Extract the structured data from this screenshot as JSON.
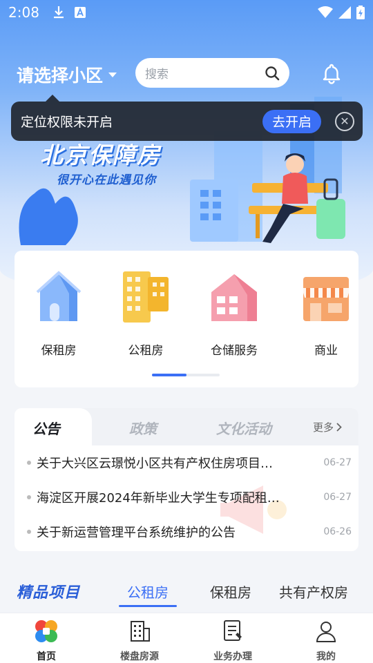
{
  "status_bar": {
    "time": "2:08"
  },
  "header": {
    "community_label": "请选择小区",
    "search_placeholder": "搜索"
  },
  "banner": {
    "title": "北京保障房",
    "subtitle": "很开心在此遇见你"
  },
  "toast": {
    "message": "定位权限未开启",
    "action_label": "去开启"
  },
  "services": [
    {
      "label": "保租房",
      "icon": "blue-house-icon",
      "color": "#6ea6f5"
    },
    {
      "label": "公租房",
      "icon": "yellow-buildings-icon",
      "color": "#f6c24a"
    },
    {
      "label": "仓储服务",
      "icon": "pink-warehouse-icon",
      "color": "#f28fa0"
    },
    {
      "label": "商业",
      "icon": "orange-shop-icon",
      "color": "#f49a5c"
    }
  ],
  "notice": {
    "tabs": [
      "公告",
      "政策",
      "文化活动"
    ],
    "more_label": "更多",
    "items": [
      {
        "title": "关于大兴区云璟悦小区共有产权住房项目…",
        "date": "06-27"
      },
      {
        "title": "海淀区开展2024年新毕业大学生专项配租…",
        "date": "06-27"
      },
      {
        "title": "关于新运营管理平台系统维护的公告",
        "date": "06-26"
      }
    ]
  },
  "projects": {
    "title": "精品项目",
    "tabs": [
      "公租房",
      "保租房",
      "共有产权房"
    ],
    "active_tab": "公租房"
  },
  "bottom_nav": [
    {
      "label": "首页",
      "icon": "home-logo-icon",
      "active": true
    },
    {
      "label": "楼盘房源",
      "icon": "building-icon",
      "active": false
    },
    {
      "label": "业务办理",
      "icon": "document-icon",
      "active": false
    },
    {
      "label": "我的",
      "icon": "user-icon",
      "active": false
    }
  ],
  "colors": {
    "accent": "#3b6ff5",
    "banner_blue": "#5a9bf6"
  }
}
